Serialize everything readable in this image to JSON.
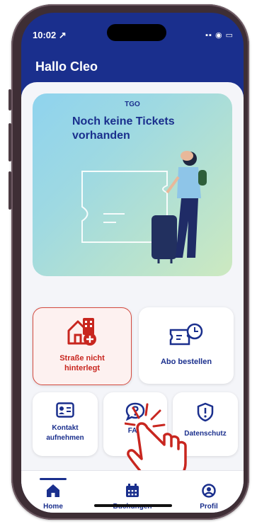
{
  "status": {
    "time": "10:02 ↗",
    "icons": "▪▪ ◉ ▭"
  },
  "header": {
    "greeting": "Hallo Cleo"
  },
  "hero": {
    "brand": "TGO",
    "title": "Noch keine Tickets vorhanden"
  },
  "tiles": [
    {
      "label": "Straße nicht hinterlegt",
      "icon": "house-plus-icon"
    },
    {
      "label": "Abo bestellen",
      "icon": "ticket-refresh-icon"
    },
    {
      "label": "Kontakt aufnehmen",
      "icon": "contact-card-icon"
    },
    {
      "label": "FAQ",
      "icon": "question-bubble-icon"
    },
    {
      "label": "Datenschutz",
      "icon": "shield-icon"
    }
  ],
  "tabs": [
    {
      "label": "Home",
      "icon": "home-icon"
    },
    {
      "label": "Buchungen",
      "icon": "calendar-icon"
    },
    {
      "label": "Profil",
      "icon": "profile-icon"
    }
  ],
  "colors": {
    "brand": "#1a2f8d",
    "warning": "#c8261f"
  }
}
